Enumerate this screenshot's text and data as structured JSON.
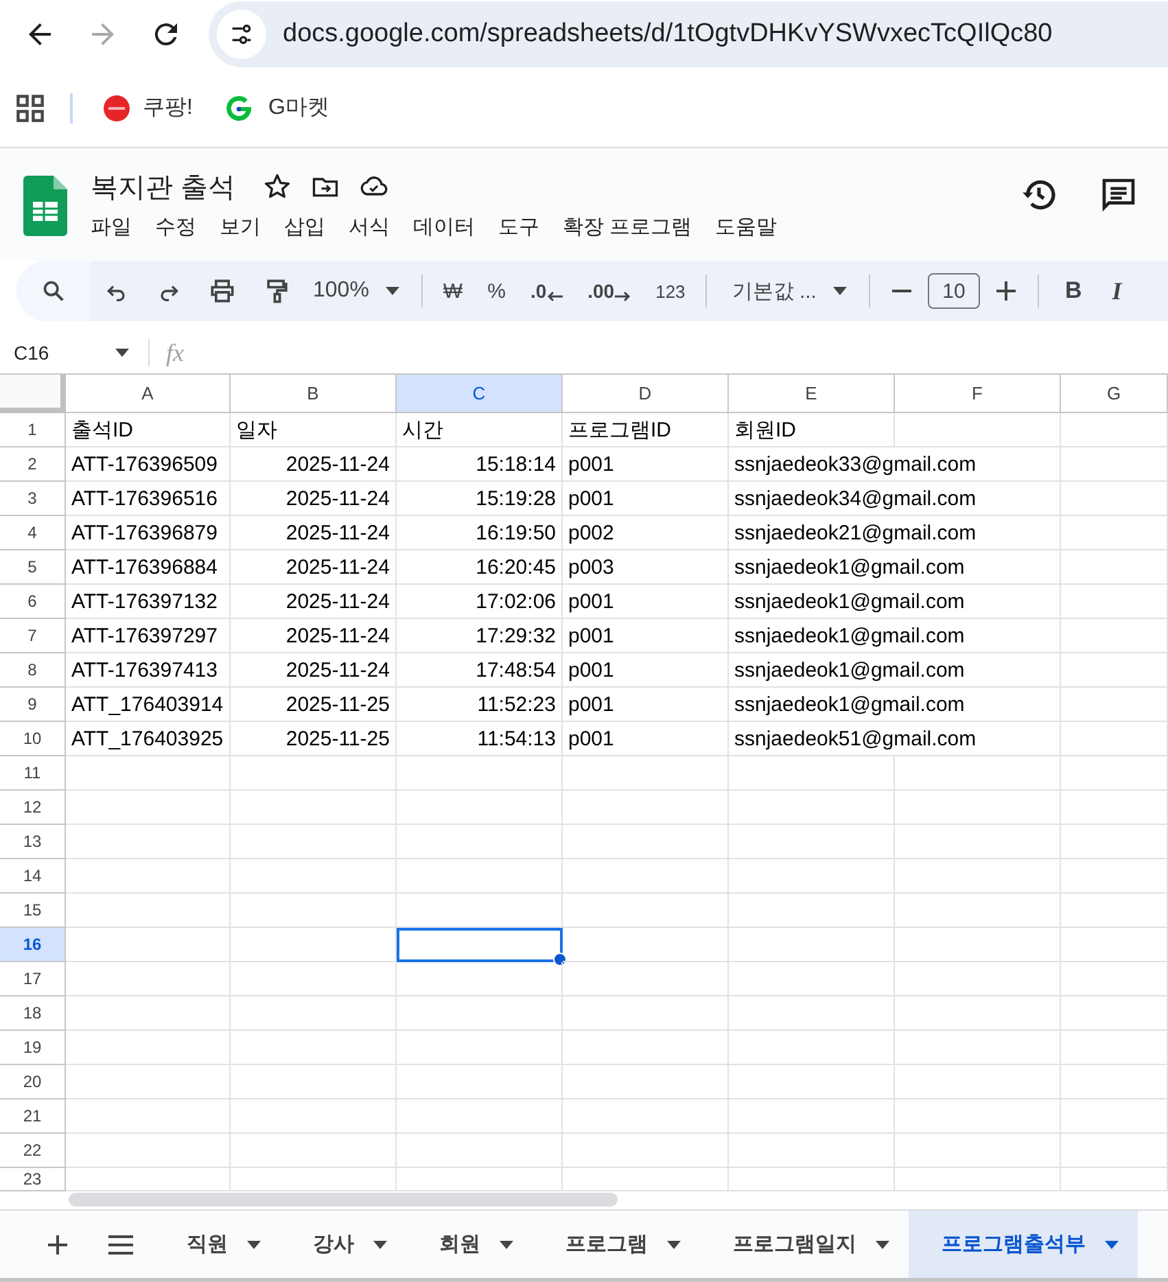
{
  "browser": {
    "forward_disabled": true,
    "url": "docs.google.com/spreadsheets/d/1tOgtvDHKvYSWvxecTcQIlQc80",
    "bookmarks": [
      {
        "kind": "coupang",
        "label": "쿠팡!"
      },
      {
        "kind": "gmarket",
        "label": "G마켓"
      }
    ]
  },
  "doc": {
    "title": "복지관 출석",
    "menu": [
      "파일",
      "수정",
      "보기",
      "삽입",
      "서식",
      "데이터",
      "도구",
      "확장 프로그램",
      "도움말"
    ]
  },
  "toolbar": {
    "zoom": "100%",
    "currency": "₩",
    "percent": "%",
    "decrease_decimal": ".0",
    "increase_decimal": ".00",
    "number_format": "123",
    "font": "기본값 ...",
    "font_size": "10",
    "bold": "B",
    "italic": "I"
  },
  "formula_bar": {
    "name_box": "C16",
    "fx": "fx"
  },
  "sheet": {
    "columns": [
      {
        "letter": "A",
        "selected": false
      },
      {
        "letter": "B",
        "selected": false
      },
      {
        "letter": "C",
        "selected": true
      },
      {
        "letter": "D",
        "selected": false
      },
      {
        "letter": "E",
        "selected": false
      },
      {
        "letter": "F",
        "selected": false
      },
      {
        "letter": "G",
        "selected": false
      }
    ],
    "rows": [
      {
        "number": "1",
        "selected": false,
        "kind": "header",
        "cells": [
          "출석ID",
          "일자",
          "시간",
          "프로그램ID",
          "회원ID"
        ]
      },
      {
        "number": "2",
        "selected": false,
        "kind": "data",
        "cells": [
          "ATT-176396509",
          "2025-11-24",
          "15:18:14",
          "p001",
          "ssnjaedeok33@gmail.com"
        ]
      },
      {
        "number": "3",
        "selected": false,
        "kind": "data",
        "cells": [
          "ATT-176396516",
          "2025-11-24",
          "15:19:28",
          "p001",
          "ssnjaedeok34@gmail.com"
        ]
      },
      {
        "number": "4",
        "selected": false,
        "kind": "data",
        "cells": [
          "ATT-176396879",
          "2025-11-24",
          "16:19:50",
          "p002",
          "ssnjaedeok21@gmail.com"
        ]
      },
      {
        "number": "5",
        "selected": false,
        "kind": "data",
        "cells": [
          "ATT-176396884",
          "2025-11-24",
          "16:20:45",
          "p003",
          "ssnjaedeok1@gmail.com"
        ]
      },
      {
        "number": "6",
        "selected": false,
        "kind": "data",
        "cells": [
          "ATT-176397132",
          "2025-11-24",
          "17:02:06",
          "p001",
          "ssnjaedeok1@gmail.com"
        ]
      },
      {
        "number": "7",
        "selected": false,
        "kind": "data",
        "cells": [
          "ATT-176397297",
          "2025-11-24",
          "17:29:32",
          "p001",
          "ssnjaedeok1@gmail.com"
        ]
      },
      {
        "number": "8",
        "selected": false,
        "kind": "data",
        "cells": [
          "ATT-176397413",
          "2025-11-24",
          "17:48:54",
          "p001",
          "ssnjaedeok1@gmail.com"
        ]
      },
      {
        "number": "9",
        "selected": false,
        "kind": "data",
        "cells": [
          "ATT_176403914",
          "2025-11-25",
          "11:52:23",
          "p001",
          "ssnjaedeok1@gmail.com"
        ]
      },
      {
        "number": "10",
        "selected": false,
        "kind": "data",
        "cells": [
          "ATT_176403925",
          "2025-11-25",
          "11:54:13",
          "p001",
          "ssnjaedeok51@gmail.com"
        ]
      },
      {
        "number": "11",
        "selected": false,
        "kind": "empty"
      },
      {
        "number": "12",
        "selected": false,
        "kind": "empty"
      },
      {
        "number": "13",
        "selected": false,
        "kind": "empty"
      },
      {
        "number": "14",
        "selected": false,
        "kind": "empty"
      },
      {
        "number": "15",
        "selected": false,
        "kind": "empty"
      },
      {
        "number": "16",
        "selected": true,
        "kind": "empty"
      },
      {
        "number": "17",
        "selected": false,
        "kind": "empty"
      },
      {
        "number": "18",
        "selected": false,
        "kind": "empty"
      },
      {
        "number": "19",
        "selected": false,
        "kind": "empty"
      },
      {
        "number": "20",
        "selected": false,
        "kind": "empty"
      },
      {
        "number": "21",
        "selected": false,
        "kind": "empty"
      },
      {
        "number": "22",
        "selected": false,
        "kind": "empty"
      },
      {
        "number": "23",
        "selected": false,
        "kind": "empty"
      }
    ]
  },
  "tabs": [
    {
      "label": "직원",
      "selected": false
    },
    {
      "label": "강사",
      "selected": false
    },
    {
      "label": "회원",
      "selected": false
    },
    {
      "label": "프로그램",
      "selected": false
    },
    {
      "label": "프로그램일지",
      "selected": false
    },
    {
      "label": "프로그램출석부",
      "selected": true
    }
  ]
}
